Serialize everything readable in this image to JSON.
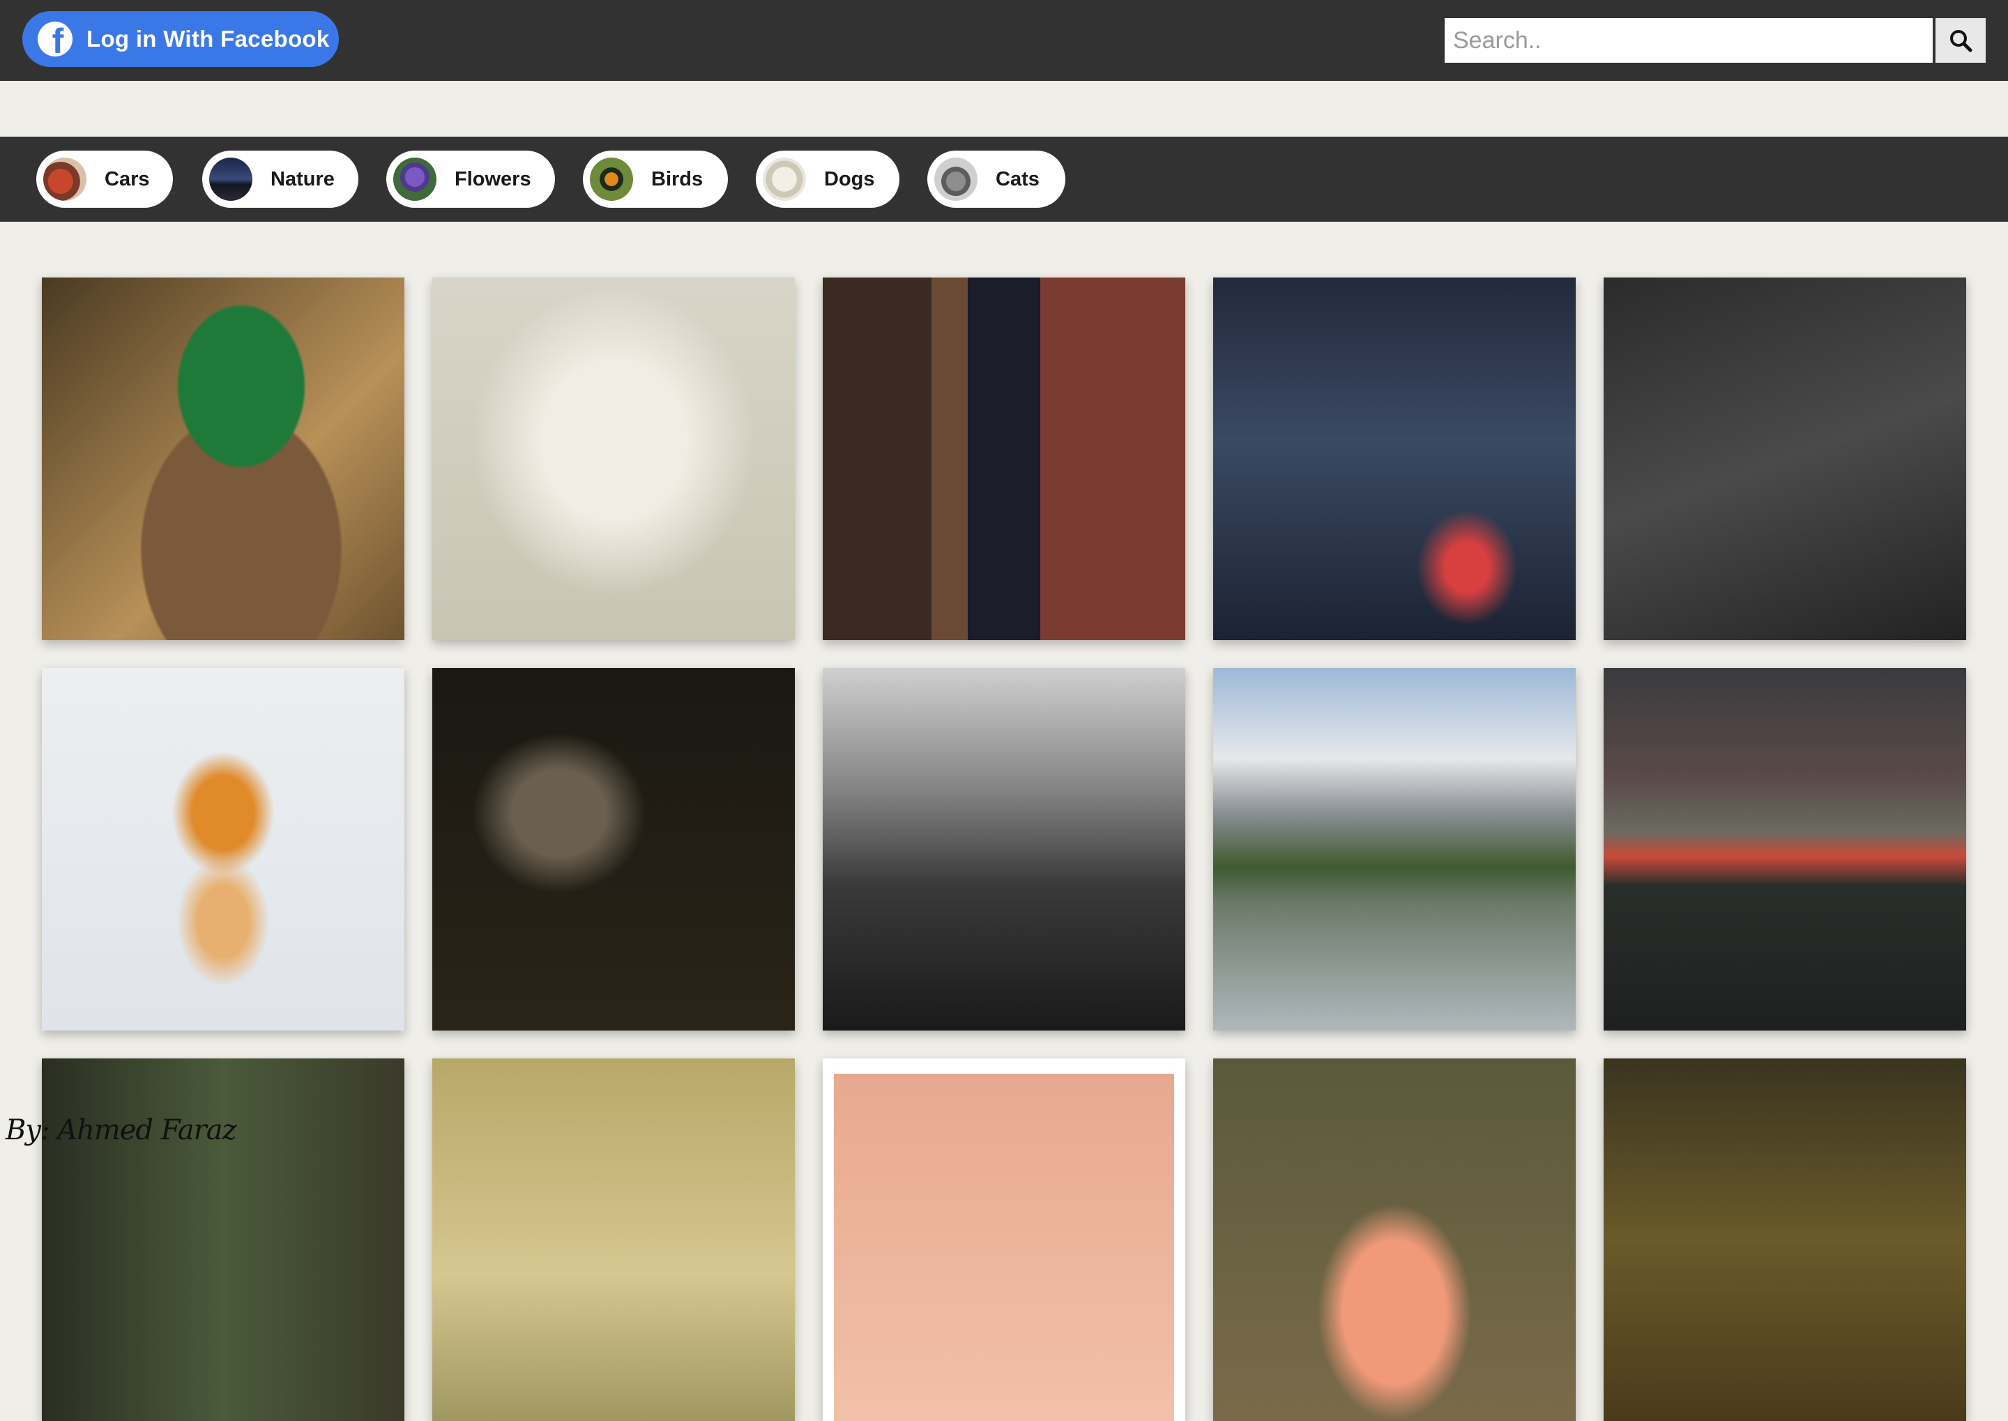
{
  "header": {
    "login_label": "Log in With Facebook",
    "search_placeholder": "Search..",
    "search_icon": "search-icon",
    "facebook_icon": "facebook-icon"
  },
  "categories": [
    {
      "label": "Cars"
    },
    {
      "label": "Nature"
    },
    {
      "label": "Flowers"
    },
    {
      "label": "Birds"
    },
    {
      "label": "Dogs"
    },
    {
      "label": "Cats"
    }
  ],
  "footer": {
    "credit": "By: Ahmed Faraz"
  },
  "colors": {
    "topbar": "#323232",
    "facebook_blue": "#3b78e7",
    "page_background": "#efeee9"
  }
}
